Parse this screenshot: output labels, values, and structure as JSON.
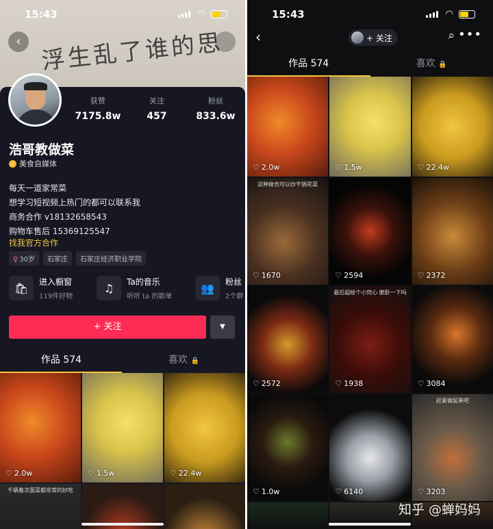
{
  "status": {
    "time": "15:43"
  },
  "profile": {
    "name": "浩哥教做菜",
    "verify_label": "美食自媒体",
    "stats": [
      {
        "label": "获赞",
        "value": "7175.8w"
      },
      {
        "label": "关注",
        "value": "457"
      },
      {
        "label": "粉丝",
        "value": "833.6w"
      }
    ],
    "bio": [
      "每天一道家常菜",
      "想学习短视频上热门的都可以联系我",
      "商务合作 v18132658543",
      "购物车售后 15369125547"
    ],
    "coop_link": "找我官方合作",
    "tags": [
      "30岁",
      "石家庄",
      "石家庄经济职业学院"
    ],
    "features": [
      {
        "title": "进入橱窗",
        "sub": "119件好物",
        "icon": "shopping-bag-icon",
        "glyph": "🛍"
      },
      {
        "title": "Ta的音乐",
        "sub": "听听 ta 的歌单",
        "icon": "music-note-icon",
        "glyph": "♫"
      },
      {
        "title": "粉丝",
        "sub": "2个群",
        "icon": "fans-group-icon",
        "glyph": "👥"
      }
    ],
    "follow_label": "+ 关注",
    "more_glyph": "▼"
  },
  "tabs": {
    "works": "作品 574",
    "likes": "喜欢"
  },
  "left_videos": [
    {
      "likes": "2.0w",
      "caption": ""
    },
    {
      "likes": "1.5w",
      "caption": ""
    },
    {
      "likes": "22.4w",
      "caption": ""
    },
    {
      "likes": "",
      "caption": "千辆着次面菜都非常的好吃"
    },
    {
      "likes": "",
      "caption": ""
    },
    {
      "likes": "",
      "caption": ""
    }
  ],
  "right_header": {
    "follow_label": "+ 关注"
  },
  "right_videos": [
    {
      "likes": "2.0w",
      "caption": ""
    },
    {
      "likes": "1.5w",
      "caption": ""
    },
    {
      "likes": "22.4w",
      "caption": ""
    },
    {
      "likes": "1670",
      "caption": "这种做也可以炒干锅花菜"
    },
    {
      "likes": "2594",
      "caption": ""
    },
    {
      "likes": "2372",
      "caption": ""
    },
    {
      "likes": "2572",
      "caption": ""
    },
    {
      "likes": "1938",
      "caption": "最后超给个小窍心 脆卧一下吗"
    },
    {
      "likes": "3084",
      "caption": ""
    },
    {
      "likes": "1.0w",
      "caption": ""
    },
    {
      "likes": "6140",
      "caption": ""
    },
    {
      "likes": "3203",
      "caption": "赶紧做起来吧"
    },
    {
      "likes": "",
      "caption": ""
    },
    {
      "likes": "",
      "caption": ""
    },
    {
      "likes": "",
      "caption": ""
    }
  ],
  "watermark": "知乎 @蝉妈妈",
  "colors": {
    "accent_red": "#fe2c55",
    "accent_yellow": "#f5c642"
  }
}
